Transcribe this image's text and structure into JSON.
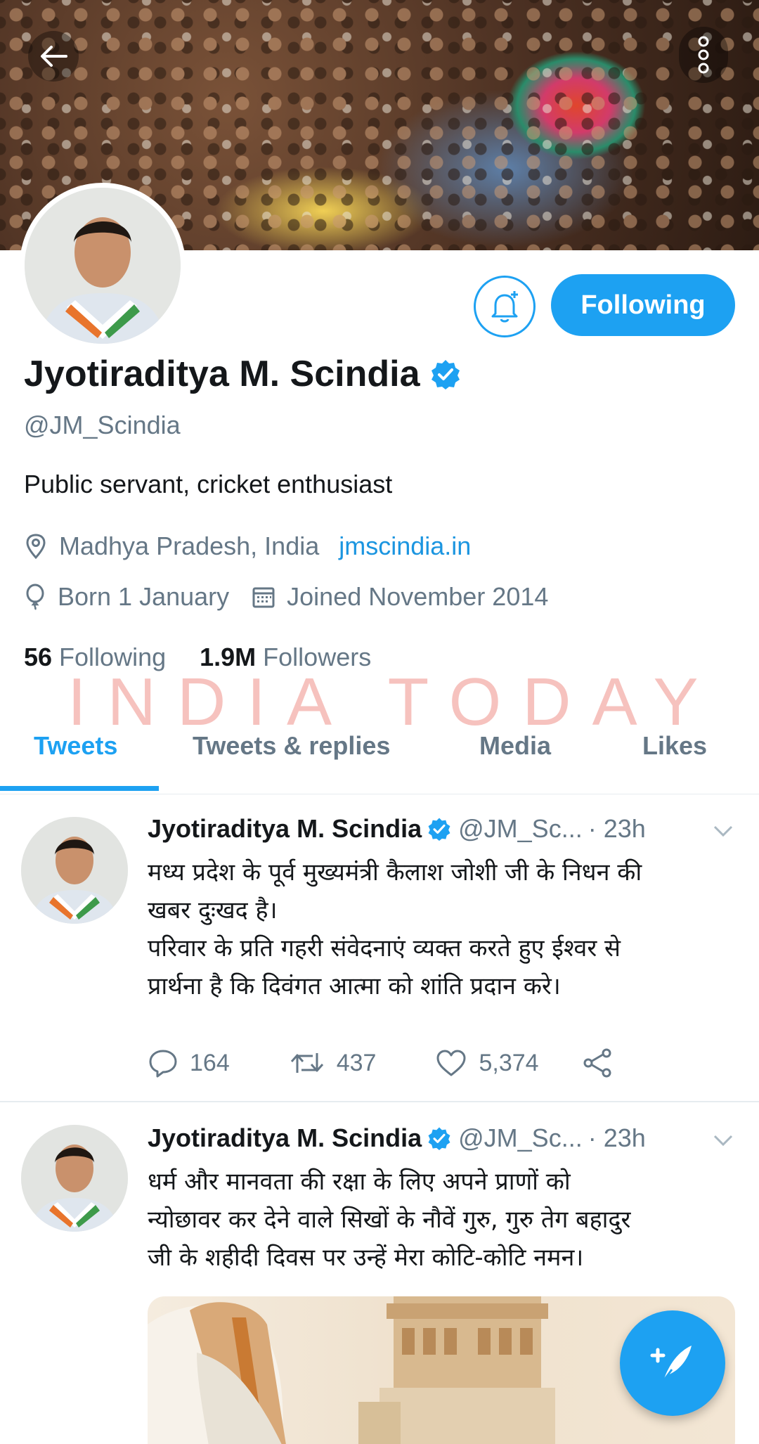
{
  "profile": {
    "display_name": "Jyotiraditya M. Scindia",
    "handle": "@JM_Scindia",
    "bio": "Public servant, cricket enthusiast",
    "location": "Madhya Pradesh, India",
    "website": "jmscindia.in",
    "birthday": "Born 1 January",
    "joined": "Joined November 2014",
    "following_count": "56",
    "following_label": "Following",
    "followers_count": "1.9M",
    "followers_label": "Followers",
    "follow_button": "Following"
  },
  "watermark": "INDIA TODAY",
  "tabs": [
    {
      "label": "Tweets",
      "active": true
    },
    {
      "label": "Tweets & replies",
      "active": false
    },
    {
      "label": "Media",
      "active": false
    },
    {
      "label": "Likes",
      "active": false
    }
  ],
  "tweets": [
    {
      "name": "Jyotiraditya M. Scindia",
      "handle": "@JM_Sc...",
      "time": "· 23h",
      "text_lines": [
        "मध्य प्रदेश के पूर्व मुख्यमंत्री कैलाश जोशी जी के निधन की",
        "खबर दुःखद है।",
        "परिवार के प्रति गहरी संवेदनाएं व्यक्त करते हुए ईश्वर से",
        "प्रार्थना है कि दिवंगत आत्मा को शांति प्रदान करे।"
      ],
      "replies": "164",
      "retweets": "437",
      "likes": "5,374"
    },
    {
      "name": "Jyotiraditya M. Scindia",
      "handle": "@JM_Sc...",
      "time": "· 23h",
      "text_lines": [
        "धर्म और मानवता की रक्षा के लिए अपने प्राणों को",
        "न्योछावर कर देने वाले सिखों के नौवें गुरु, गुरु तेग बहादुर",
        "जी के शहीदी दिवस पर उन्हें मेरा कोटि-कोटि नमन।"
      ]
    }
  ],
  "colors": {
    "accent": "#1da1f2",
    "link": "#1b95e0",
    "secondary_text": "#657786",
    "primary_text": "#14171a",
    "watermark": "#eb786e"
  },
  "icons": [
    "back-arrow-icon",
    "more-vertical-icon",
    "notification-bell-icon",
    "verified-badge-icon",
    "location-pin-icon",
    "birthday-balloon-icon",
    "calendar-icon",
    "chevron-down-icon",
    "reply-icon",
    "retweet-icon",
    "like-icon",
    "share-icon",
    "compose-tweet-icon"
  ]
}
